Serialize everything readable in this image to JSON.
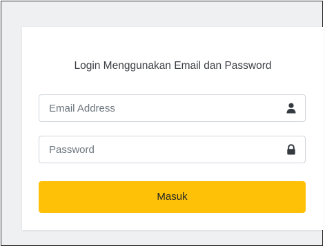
{
  "login": {
    "title": "Login Menggunakan Email dan Password",
    "email": {
      "placeholder": "Email Address",
      "value": "",
      "icon": "user-icon"
    },
    "password": {
      "placeholder": "Password",
      "value": "",
      "icon": "lock-icon"
    },
    "submit_label": "Masuk"
  },
  "colors": {
    "page_background": "#eef0f2",
    "card_background": "#ffffff",
    "button": "#ffc107",
    "field_border": "#ced4da",
    "icon": "#343a40"
  }
}
